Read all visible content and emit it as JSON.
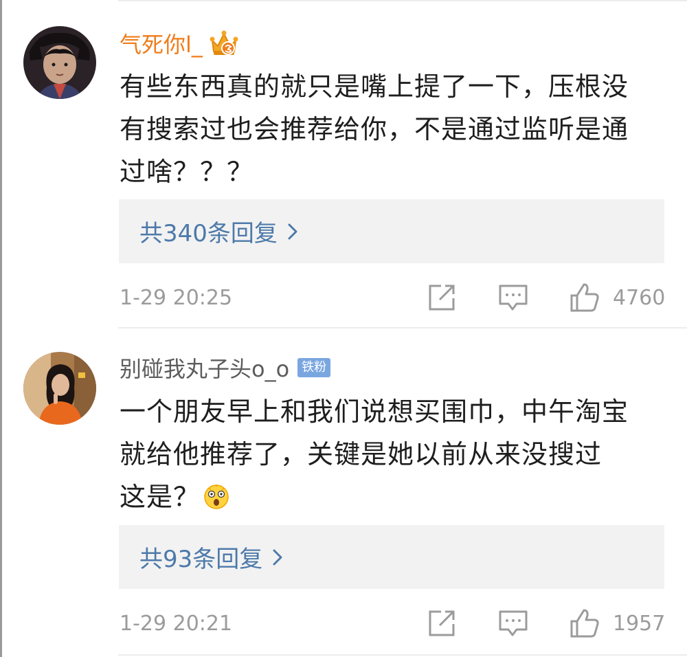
{
  "comments": [
    {
      "username": "气死你l_",
      "badge_icon": "vip-crown-icon",
      "text_lines": [
        "有些东西真的就只是嘴上提了一下，压根没",
        "有搜索过也会推荐给你，不是通过监听是通",
        "过啥？？？"
      ],
      "replies_label": "共340条回复",
      "time": "1-29 20:25",
      "likes": "4760"
    },
    {
      "username": "别碰我丸子头o_o",
      "badge_label": "铁粉",
      "text_lines": [
        "一个朋友早上和我们说想买围巾，中午淘宝",
        "就给他推荐了，关键是她以前从来没搜过",
        "这是？"
      ],
      "trailing_emoji": "shocked-face-emoji",
      "replies_label": "共93条回复",
      "time": "1-29 20:21",
      "likes": "1957"
    }
  ],
  "colors": {
    "vip_name": "#f07c1b",
    "normal_name": "#5c5c5c",
    "link_blue": "#4d79a9",
    "meta_gray": "#9b9b9b",
    "reply_bg": "#f2f2f2",
    "fan_badge_bg": "#7aa6e0"
  }
}
